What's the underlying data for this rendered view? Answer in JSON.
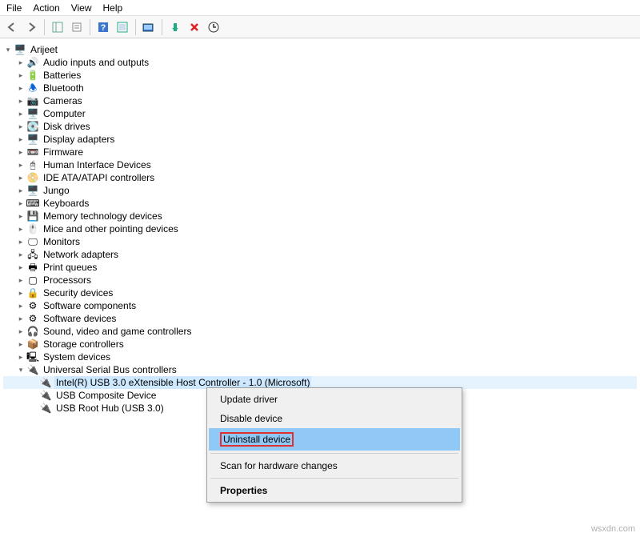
{
  "menubar": {
    "file": "File",
    "action": "Action",
    "view": "View",
    "help": "Help"
  },
  "toolbar_icons": {
    "back": "back",
    "forward": "forward",
    "show_hide": "show-hide-tree",
    "properties": "properties",
    "help": "help",
    "refresh": "refresh",
    "monitor": "scan",
    "add": "add-legacy",
    "remove": "remove",
    "update": "update"
  },
  "tree": {
    "root": "Arijeet",
    "categories": [
      "Audio inputs and outputs",
      "Batteries",
      "Bluetooth",
      "Cameras",
      "Computer",
      "Disk drives",
      "Display adapters",
      "Firmware",
      "Human Interface Devices",
      "IDE ATA/ATAPI controllers",
      "Jungo",
      "Keyboards",
      "Memory technology devices",
      "Mice and other pointing devices",
      "Monitors",
      "Network adapters",
      "Print queues",
      "Processors",
      "Security devices",
      "Software components",
      "Software devices",
      "Sound, video and game controllers",
      "Storage controllers",
      "System devices",
      "Universal Serial Bus controllers"
    ],
    "usb_children": [
      "Intel(R) USB 3.0 eXtensible Host Controller - 1.0 (Microsoft)",
      "USB Composite Device",
      "USB Root Hub (USB 3.0)"
    ]
  },
  "context_menu": {
    "update": "Update driver",
    "disable": "Disable device",
    "uninstall": "Uninstall device",
    "scan": "Scan for hardware changes",
    "properties": "Properties"
  },
  "icons": {
    "computer_root": "🖥️",
    "audio": "🔊",
    "batteries": "🔋",
    "bluetooth": "🕭",
    "cameras": "📷",
    "computer": "🖥️",
    "disk": "💽",
    "display": "🖥️",
    "firmware": "📼",
    "hid": "🖰",
    "ide": "📀",
    "jungo": "🖥️",
    "keyboards": "⌨",
    "memory": "💾",
    "mice": "🖱️",
    "monitors": "🖵",
    "network": "🖧",
    "print": "🖶",
    "processors": "▢",
    "security": "🔒",
    "swcomp": "⚙",
    "swdev": "⚙",
    "sound": "🎧",
    "storage": "📦",
    "system": "🖳",
    "usb": "🔌"
  },
  "watermark": "wsxdn.com"
}
